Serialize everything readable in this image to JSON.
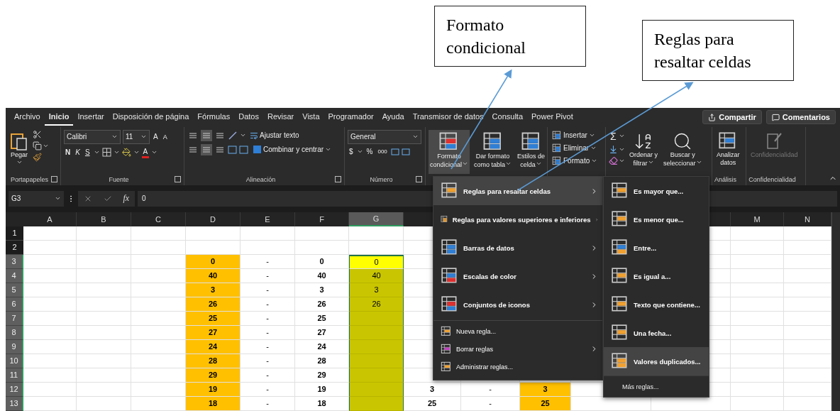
{
  "callouts": [
    {
      "text": "Formato condicional"
    },
    {
      "text": "Reglas para resaltar celdas"
    }
  ],
  "tabs": [
    {
      "label": "Archivo",
      "selected": false
    },
    {
      "label": "Inicio",
      "selected": true
    },
    {
      "label": "Insertar",
      "selected": false
    },
    {
      "label": "Disposición de página",
      "selected": false
    },
    {
      "label": "Fórmulas",
      "selected": false
    },
    {
      "label": "Datos",
      "selected": false
    },
    {
      "label": "Revisar",
      "selected": false
    },
    {
      "label": "Vista",
      "selected": false
    },
    {
      "label": "Programador",
      "selected": false
    },
    {
      "label": "Ayuda",
      "selected": false
    },
    {
      "label": "Transmisor de datos",
      "selected": false
    },
    {
      "label": "Consulta",
      "selected": false
    },
    {
      "label": "Power Pivot",
      "selected": false
    }
  ],
  "header_buttons": [
    {
      "kind": "share",
      "label": "Compartir"
    },
    {
      "kind": "comments",
      "label": "Comentarios"
    }
  ],
  "ribbon_groups": [
    {
      "kind": "clipboard",
      "label": "Portapapeles",
      "launcher": true,
      "paste": "Pegar"
    },
    {
      "kind": "font",
      "label": "Fuente",
      "launcher": true,
      "font": "Calibri",
      "size": "11",
      "grow": "A",
      "shrink": "A",
      "styles": [
        "N",
        "K",
        "S"
      ],
      "font_color": "A"
    },
    {
      "kind": "alignment",
      "label": "Alineación",
      "launcher": true,
      "vertical": [
        {
          "selected": false
        },
        {
          "selected": true
        },
        {
          "selected": false
        }
      ],
      "horizontal": [
        {
          "selected": false
        },
        {
          "selected": true
        },
        {
          "selected": false
        }
      ],
      "wrap": "Ajustar texto",
      "merge": "Combinar y centrar"
    },
    {
      "kind": "number",
      "label": "Número",
      "launcher": true,
      "format": "General",
      "currency": "$",
      "percent": "%",
      "thousands": "000"
    },
    {
      "kind": "styles",
      "buttons": [
        {
          "lines": [
            "Formato",
            "condicional"
          ],
          "selected": true
        },
        {
          "lines": [
            "Dar formato",
            "como tabla"
          ],
          "selected": false
        },
        {
          "lines": [
            "Estilos de",
            "celda"
          ],
          "selected": false
        }
      ]
    },
    {
      "kind": "cells",
      "buttons": [
        "Insertar",
        "Eliminar",
        "Formato"
      ]
    },
    {
      "kind": "editing",
      "sum": "Σ",
      "buttons": [
        {
          "lines": [
            "Ordenar y",
            "filtrar"
          ]
        },
        {
          "lines": [
            "Buscar y",
            "seleccionar"
          ]
        }
      ]
    },
    {
      "kind": "analysis",
      "label": "Análisis",
      "button": {
        "lines": [
          "Analizar",
          "datos"
        ]
      }
    },
    {
      "kind": "sensitivity",
      "label": "Confidencialidad",
      "button": {
        "lines": [
          "Confidencialidad"
        ],
        "disabled": true
      }
    }
  ],
  "formula_bar": {
    "name_box": "G3",
    "fx": "fx",
    "value": "0"
  },
  "columns": [
    {
      "label": "A",
      "selected": false
    },
    {
      "label": "B",
      "selected": false
    },
    {
      "label": "C",
      "selected": false
    },
    {
      "label": "D",
      "selected": false
    },
    {
      "label": "E",
      "selected": false
    },
    {
      "label": "F",
      "selected": false
    },
    {
      "label": "G",
      "selected": true
    },
    {
      "label": "M",
      "selected": false
    },
    {
      "label": "N",
      "selected": false
    }
  ],
  "rows": [
    {
      "number": "1",
      "selected": false,
      "cells": {}
    },
    {
      "number": "2",
      "selected": false,
      "cells": {}
    },
    {
      "number": "3",
      "selected": true,
      "cells": {
        "D": {
          "value": "0",
          "bold": true,
          "color": "#ffc000"
        },
        "E": {
          "value": "-",
          "bold": false
        },
        "F": {
          "value": "0",
          "bold": true
        },
        "G": {
          "value": "0",
          "bold": false,
          "color": "#ffff00",
          "selected": true,
          "active": true
        }
      }
    },
    {
      "number": "4",
      "selected": true,
      "cells": {
        "D": {
          "value": "40",
          "bold": true,
          "color": "#ffc000"
        },
        "E": {
          "value": "-",
          "bold": false
        },
        "F": {
          "value": "40",
          "bold": true
        },
        "G": {
          "value": "40",
          "bold": false,
          "color": "#c9c500",
          "selected": true,
          "active": false
        }
      }
    },
    {
      "number": "5",
      "selected": true,
      "cells": {
        "D": {
          "value": "3",
          "bold": true,
          "color": "#ffc000"
        },
        "E": {
          "value": "-",
          "bold": false
        },
        "F": {
          "value": "3",
          "bold": true
        },
        "G": {
          "value": "3",
          "bold": false,
          "color": "#c9c500",
          "selected": true,
          "active": false
        }
      }
    },
    {
      "number": "6",
      "selected": true,
      "cells": {
        "D": {
          "value": "26",
          "bold": true,
          "color": "#ffc000"
        },
        "E": {
          "value": "-",
          "bold": false
        },
        "F": {
          "value": "26",
          "bold": true
        },
        "G": {
          "value": "26",
          "bold": false,
          "color": "#c9c500",
          "selected": true,
          "active": false
        }
      }
    },
    {
      "number": "7",
      "selected": true,
      "cells": {
        "D": {
          "value": "25",
          "bold": true,
          "color": "#ffc000"
        },
        "E": {
          "value": "-",
          "bold": false
        },
        "F": {
          "value": "25",
          "bold": true
        },
        "G": {
          "color": "#c9c500",
          "selected": true,
          "active": false
        }
      }
    },
    {
      "number": "8",
      "selected": true,
      "cells": {
        "D": {
          "value": "27",
          "bold": true,
          "color": "#ffc000"
        },
        "E": {
          "value": "-",
          "bold": false
        },
        "F": {
          "value": "27",
          "bold": true
        },
        "G": {
          "color": "#c9c500",
          "selected": true,
          "active": false
        }
      }
    },
    {
      "number": "9",
      "selected": true,
      "cells": {
        "D": {
          "value": "24",
          "bold": true,
          "color": "#ffc000"
        },
        "E": {
          "value": "-",
          "bold": false
        },
        "F": {
          "value": "24",
          "bold": true
        },
        "G": {
          "color": "#c9c500",
          "selected": true,
          "active": false
        }
      }
    },
    {
      "number": "10",
      "selected": true,
      "cells": {
        "D": {
          "value": "28",
          "bold": true,
          "color": "#ffc000"
        },
        "E": {
          "value": "-",
          "bold": false
        },
        "F": {
          "value": "28",
          "bold": true
        },
        "G": {
          "color": "#c9c500",
          "selected": true,
          "active": false
        }
      }
    },
    {
      "number": "11",
      "selected": true,
      "cells": {
        "D": {
          "value": "29",
          "bold": true,
          "color": "#ffc000"
        },
        "E": {
          "value": "-",
          "bold": false
        },
        "F": {
          "value": "29",
          "bold": true
        },
        "G": {
          "color": "#c9c500",
          "selected": true,
          "active": false
        }
      }
    },
    {
      "number": "12",
      "selected": true,
      "cells": {
        "D": {
          "value": "19",
          "bold": true,
          "color": "#ffc000"
        },
        "E": {
          "value": "-",
          "bold": false
        },
        "F": {
          "value": "19",
          "bold": true
        },
        "G": {
          "color": "#c9c500",
          "selected": true,
          "active": false
        },
        "H": {
          "value": "3",
          "bold": true
        },
        "I": {
          "value": "-",
          "bold": false
        },
        "J": {
          "value": "3",
          "bold": true,
          "color": "#ffc000"
        }
      }
    },
    {
      "number": "13",
      "selected": true,
      "cells": {
        "D": {
          "value": "18",
          "bold": true,
          "color": "#ffc000"
        },
        "E": {
          "value": "-",
          "bold": false
        },
        "F": {
          "value": "18",
          "bold": true
        },
        "G": {
          "color": "#c9c500",
          "selected": true,
          "active": false
        },
        "H": {
          "value": "25",
          "bold": true
        },
        "I": {
          "value": "-",
          "bold": false
        },
        "J": {
          "value": "25",
          "bold": true,
          "color": "#ffc000"
        }
      }
    }
  ],
  "conditional_menu": {
    "items": [
      {
        "kind": "highlight",
        "label": "Reglas para resaltar celdas",
        "selected": true,
        "submenu": true
      },
      {
        "kind": "topbottom",
        "label": "Reglas para valores superiores e inferiores",
        "selected": false,
        "submenu": true
      },
      {
        "kind": "databars",
        "label": "Barras de datos",
        "selected": false,
        "submenu": true
      },
      {
        "kind": "colorscales",
        "label": "Escalas de color",
        "selected": false,
        "submenu": true
      },
      {
        "kind": "iconsets",
        "label": "Conjuntos de iconos",
        "selected": false,
        "submenu": true
      },
      {
        "kind": "new",
        "label": "Nueva regla...",
        "selected": false,
        "submenu": false
      },
      {
        "kind": "clear",
        "label": "Borrar reglas",
        "selected": false,
        "submenu": true
      },
      {
        "kind": "manage",
        "label": "Administrar reglas...",
        "selected": false,
        "submenu": false
      }
    ]
  },
  "highlight_submenu": {
    "items": [
      {
        "kind": "greater",
        "label": "Es mayor que...",
        "selected": false
      },
      {
        "kind": "less",
        "label": "Es menor que...",
        "selected": false
      },
      {
        "kind": "between",
        "label": "Entre...",
        "selected": false
      },
      {
        "kind": "equal",
        "label": "Es igual a...",
        "selected": false
      },
      {
        "kind": "text",
        "label": "Texto que contiene...",
        "selected": false
      },
      {
        "kind": "date",
        "label": "Una fecha...",
        "selected": false
      },
      {
        "kind": "duplicate",
        "label": "Valores duplicados...",
        "selected": true
      }
    ],
    "more": "Más reglas..."
  }
}
